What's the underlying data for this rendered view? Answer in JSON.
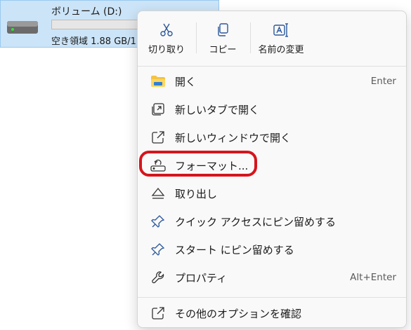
{
  "drive": {
    "name": "ボリューム (D:)",
    "free_text": "空き領域 1.88 GB/1",
    "usage_fraction": 0.0
  },
  "quick_actions": {
    "cut": "切り取り",
    "copy": "コピー",
    "rename": "名前の変更"
  },
  "menu_items": [
    {
      "label": "開く",
      "shortcut": "Enter",
      "icon": "folder-icon"
    },
    {
      "label": "新しいタブで開く",
      "shortcut": "",
      "icon": "open-new-tab-icon"
    },
    {
      "label": "新しいウィンドウで開く",
      "shortcut": "",
      "icon": "open-new-window-icon"
    },
    {
      "label": "フォーマット...",
      "shortcut": "",
      "icon": "format-icon"
    },
    {
      "label": "取り出し",
      "shortcut": "",
      "icon": "eject-icon"
    },
    {
      "label": "クイック アクセスにピン留めする",
      "shortcut": "",
      "icon": "pin-icon"
    },
    {
      "label": "スタート にピン留めする",
      "shortcut": "",
      "icon": "pin-icon"
    },
    {
      "label": "プロパティ",
      "shortcut": "Alt+Enter",
      "icon": "wrench-icon"
    },
    {
      "label": "その他のオプションを確認",
      "shortcut": "",
      "icon": "more-options-icon"
    }
  ],
  "colors": {
    "selection": "#cce4f7",
    "accent": "#0067c0",
    "highlight": "#d6141c"
  }
}
